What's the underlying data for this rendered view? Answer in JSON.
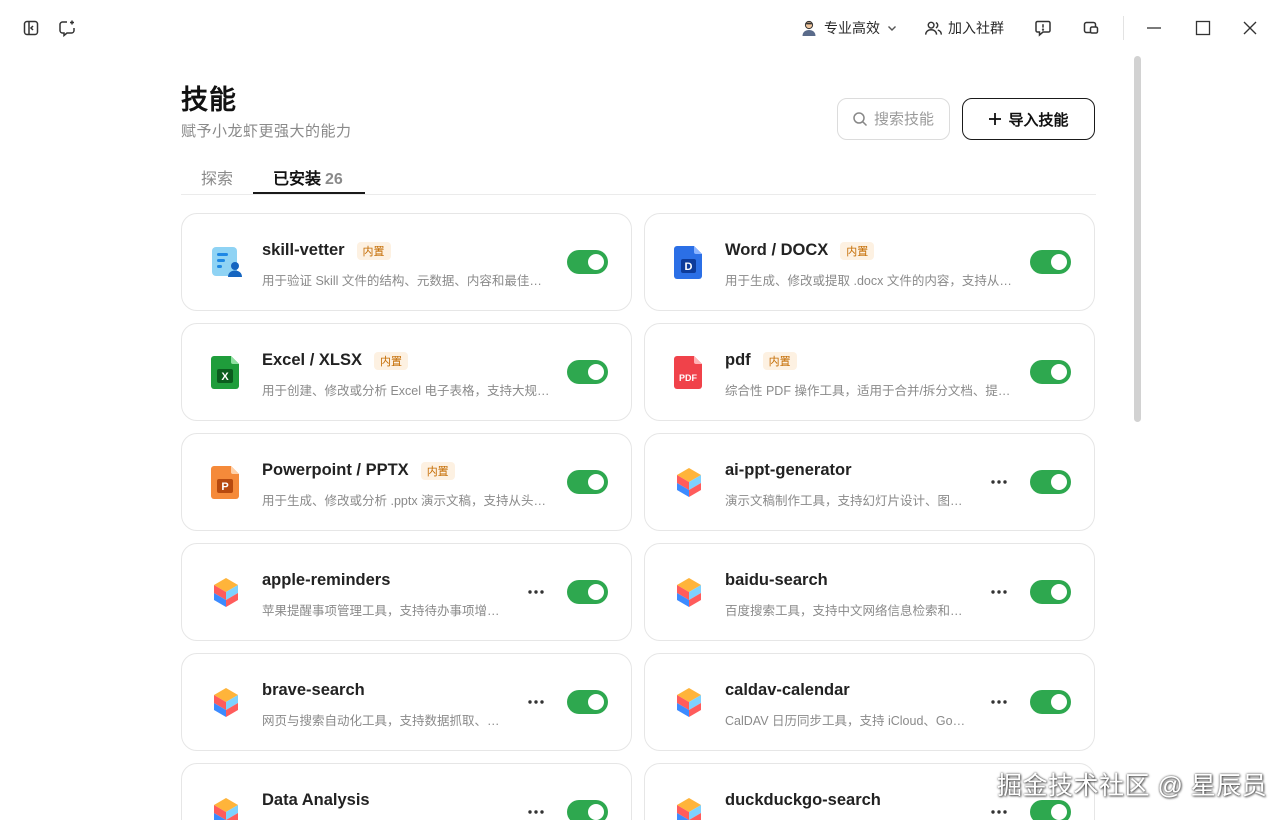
{
  "topbar": {
    "profile_label": "专业高效",
    "community_label": "加入社群"
  },
  "header": {
    "title": "技能",
    "subtitle": "赋予小龙虾更强大的能力",
    "search_placeholder": "搜索技能",
    "import_label": "导入技能"
  },
  "tabs": {
    "explore": "探索",
    "installed": "已安装",
    "installed_count": "26"
  },
  "skills": [
    {
      "name": "skill-vetter",
      "badge": "内置",
      "desc": "用于验证 Skill 文件的结构、元数据、内容和最佳实…",
      "icon": "skill-vetter-icon",
      "has_more": false,
      "enabled": true
    },
    {
      "name": "Word / DOCX",
      "badge": "内置",
      "desc": "用于生成、修改或提取 .docx 文件的内容，支持从头…",
      "icon": "word-icon",
      "has_more": false,
      "enabled": true
    },
    {
      "name": "Excel / XLSX",
      "badge": "内置",
      "desc": "用于创建、修改或分析 Excel 电子表格，支持大规模…",
      "icon": "excel-icon",
      "has_more": false,
      "enabled": true
    },
    {
      "name": "pdf",
      "badge": "内置",
      "desc": "综合性 PDF 操作工具，适用于合并/拆分文档、提取…",
      "icon": "pdf-icon",
      "has_more": false,
      "enabled": true
    },
    {
      "name": "Powerpoint / PPTX",
      "badge": "内置",
      "desc": "用于生成、修改或分析 .pptx 演示文稿，支持从头构…",
      "icon": "powerpoint-icon",
      "has_more": false,
      "enabled": true
    },
    {
      "name": "ai-ppt-generator",
      "badge": "",
      "desc": "演示文稿制作工具，支持幻灯片设计、图表…",
      "icon": "cube-icon",
      "has_more": true,
      "enabled": true
    },
    {
      "name": "apple-reminders",
      "badge": "",
      "desc": "苹果提醒事项管理工具，支持待办事项增删…",
      "icon": "cube-icon",
      "has_more": true,
      "enabled": true
    },
    {
      "name": "baidu-search",
      "badge": "",
      "desc": "百度搜索工具，支持中文网络信息检索和实…",
      "icon": "cube-icon",
      "has_more": true,
      "enabled": true
    },
    {
      "name": "brave-search",
      "badge": "",
      "desc": "网页与搜索自动化工具，支持数据抓取、页…",
      "icon": "cube-icon",
      "has_more": true,
      "enabled": true
    },
    {
      "name": "caldav-calendar",
      "badge": "",
      "desc": "CalDAV 日历同步工具，支持 iCloud、Goo…",
      "icon": "cube-icon",
      "has_more": true,
      "enabled": true
    },
    {
      "name": "Data Analysis",
      "badge": "",
      "desc": "",
      "icon": "cube-icon",
      "has_more": true,
      "enabled": true
    },
    {
      "name": "duckduckgo-search",
      "badge": "",
      "desc": "",
      "icon": "cube-icon",
      "has_more": true,
      "enabled": true
    }
  ],
  "watermark": "掘金技术社区 @ 星辰员",
  "colors": {
    "toggle_on": "#2ea84f",
    "badge_text": "#c46b00",
    "badge_bg": "#fdf1e2"
  }
}
